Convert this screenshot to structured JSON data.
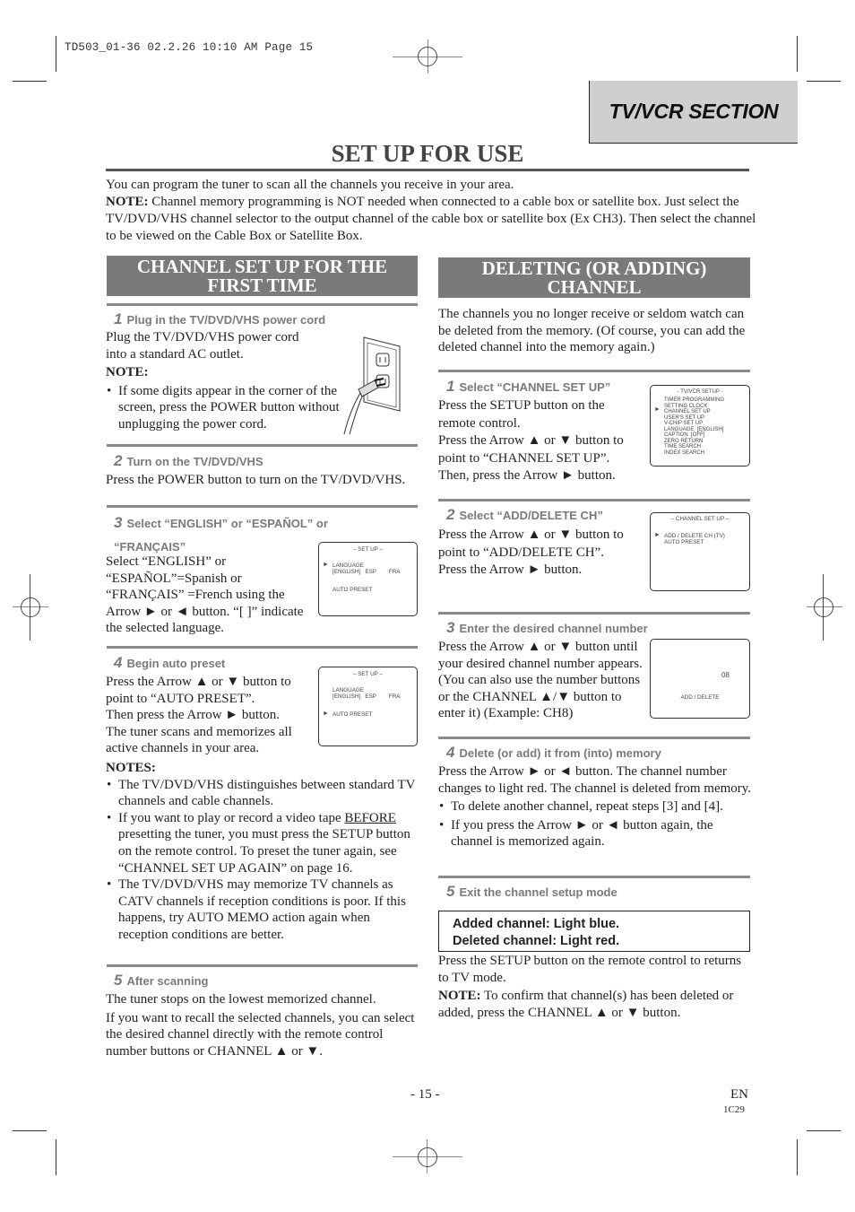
{
  "slug": "TD503_01-36  02.2.26  10:10 AM  Page 15",
  "section_tab": "TV/VCR SECTION",
  "page_title": "SET UP FOR USE",
  "intro": {
    "line1": "You can program the tuner to scan all the channels you receive in your area.",
    "note_label": "NOTE:",
    "note_text": " Channel memory programming is NOT needed when connected to a cable box or satellite box. Just select the TV/DVD/VHS channel selector to the output channel of the cable box or satellite box (Ex CH3). Then select the channel to be viewed on the Cable Box or Satellite Box."
  },
  "left": {
    "heading_line1": "CHANNEL SET UP FOR THE",
    "heading_line2": "FIRST TIME",
    "steps": [
      {
        "num": "1",
        "title": "Plug in the TV/DVD/VHS power cord",
        "text1": "Plug the TV/DVD/VHS power cord",
        "text2": "into a standard AC outlet.",
        "note_label": "NOTE:",
        "bullet": "If some digits appear in the corner of the screen, press the POWER button without unplugging the power cord."
      },
      {
        "num": "2",
        "title": "Turn on the TV/DVD/VHS",
        "text": "Press the POWER button to turn on the TV/DVD/VHS."
      },
      {
        "num": "3",
        "title_line1": "Select “ENGLISH” or “ESPAÑOL” or",
        "title_line2": "“FRANÇAIS”",
        "text": "Select “ENGLISH” or “ESPAÑOL”=Spanish or “FRANÇAIS” =French using the Arrow ► or ◄ button. “[ ]” indicate the selected language."
      },
      {
        "num": "4",
        "title": "Begin auto preset",
        "text1": "Press the Arrow ▲ or ▼ button to point to “AUTO PRESET”.",
        "text2": "Then press the Arrow ► button.",
        "text3": "The tuner scans and memorizes all active channels in your area.",
        "notes_label": "NOTES:",
        "bullet1": "The TV/DVD/VHS distinguishes between standard TV channels and cable channels.",
        "bullet2_pre": "If you want to play or record a video tape ",
        "bullet2_u": "BEFORE",
        "bullet2_post": " presetting the tuner, you must press the SETUP button on the remote control. To preset the tuner again, see “CHANNEL SET UP AGAIN” on page 16.",
        "bullet3": "The TV/DVD/VHS may memorize TV channels as CATV channels if reception conditions is poor. If this happens, try AUTO MEMO action again when reception conditions are better."
      },
      {
        "num": "5",
        "title": "After scanning",
        "text1": "The tuner stops on the lowest memorized channel.",
        "text2": "If you want to recall the selected channels, you can select the desired channel directly with the remote control number buttons or CHANNEL ▲ or ▼."
      }
    ],
    "osd_setup": {
      "title": "– SET UP –",
      "language": "LANGUAGE",
      "options": "[ENGLISH]   ESP        FRA",
      "auto_preset": "AUTO PRESET",
      "pointer": "►"
    }
  },
  "right": {
    "heading_line1": "DELETING (OR ADDING)",
    "heading_line2": "CHANNEL",
    "intro": "The channels you no longer receive or seldom watch can be deleted from the memory. (Of course, you can add the deleted channel into the memory again.)",
    "steps": [
      {
        "num": "1",
        "title": "Select “CHANNEL SET UP”",
        "text1": "Press the SETUP button on the remote control.",
        "text2": "Press the Arrow ▲ or ▼ button to point to “CHANNEL SET UP”.",
        "text3": "Then, press the Arrow ► button."
      },
      {
        "num": "2",
        "title": "Select “ADD/DELETE CH”",
        "text1": "Press the Arrow ▲ or ▼ button to point to “ADD/DELETE CH”.",
        "text2": "Press the Arrow ► button."
      },
      {
        "num": "3",
        "title": "Enter the desired channel number",
        "text": "Press the Arrow ▲ or ▼ button until your desired channel number appears. (You can also use the number buttons  or the CHANNEL ▲/▼ button to enter it) (Example: CH8)"
      },
      {
        "num": "4",
        "title": "Delete (or add) it from (into) memory",
        "text": "Press the Arrow ► or ◄ button. The channel number changes to light red. The channel is deleted from memory.",
        "bullet1": "To delete another channel, repeat steps [3] and [4].",
        "bullet2": "If you press the Arrow ► or ◄ button again, the channel is memorized again."
      },
      {
        "num": "5",
        "title": "Exit the channel setup mode",
        "legend_added": "Added channel: Light blue.",
        "legend_deleted": "Deleted channel: Light red.",
        "text": "Press the SETUP button on the remote control to returns to TV mode.",
        "note_label": "NOTE:",
        "note_text": " To confirm that channel(s) has been deleted or added, press the CHANNEL ▲ or ▼ button."
      }
    ],
    "osd_tvvcr": {
      "title": "- TV/VCR SETUP -",
      "items": [
        "TIMER PROGRAMMING",
        "SETTING CLOCK",
        "CHANNEL SET UP",
        "USER'S SET UP",
        "V-CHIP SET UP",
        "LANGUAGE  [ENGLISH]",
        "CAPTION  [OFF]",
        "ZERO RETURN",
        "TIME SEARCH",
        "INDEX SEARCH"
      ],
      "pointer": "►"
    },
    "osd_channel": {
      "title": "– CHANNEL SET UP –",
      "items": [
        "ADD / DELETE CH (TV)",
        "AUTO PRESET"
      ],
      "pointer": "►"
    },
    "osd_adddelete": {
      "channel": "08",
      "label": "ADD / DELETE"
    }
  },
  "footer": {
    "page_number": "- 15 -",
    "lang": "EN",
    "code": "1C29"
  }
}
